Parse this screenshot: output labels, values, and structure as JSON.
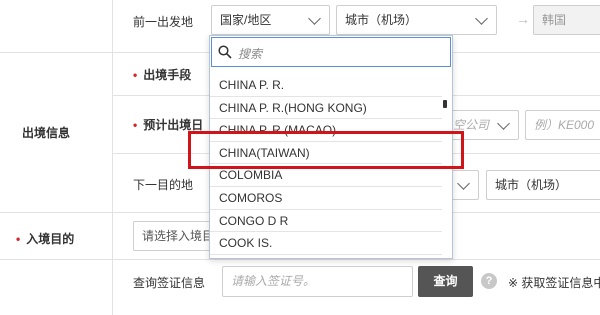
{
  "form": {
    "prev_departure_label": "前一出发地",
    "country_select": "国家/地区",
    "city_select": "城市（机场）",
    "destination_value": "韩国",
    "section_label": "出境信息",
    "exit_means_label": "出境手段",
    "planned_exit_label": "预计出境日",
    "airline_placeholder_fragment": "空公司",
    "flight_placeholder": "例）KE000",
    "next_dest_label": "下一目的地",
    "next_city_select": "城市（机场）",
    "entry_purpose_label": "入境目的",
    "entry_purpose_placeholder": "请选择入境目",
    "visa_query_label": "查询签证信息",
    "visa_input_placeholder": "请输入签证号。",
    "query_button": "查询",
    "help_icon_text": "?",
    "visa_note": "※ 获取签证信息中"
  },
  "dropdown": {
    "search_placeholder": "搜索",
    "items": [
      "CHINA P. R.",
      "CHINA P. R.(HONG KONG)",
      "CHINA P. R.(MACAO)",
      "CHINA(TAIWAN)",
      "COLOMBIA",
      "COMOROS",
      "CONGO D R",
      "COOK IS."
    ],
    "highlighted_item": "CHINA(TAIWAN)"
  },
  "colors": {
    "required_mark": "#d6262a",
    "highlight_border": "#d0141a",
    "query_button_bg": "#555555",
    "search_border": "#5a8fd8"
  }
}
